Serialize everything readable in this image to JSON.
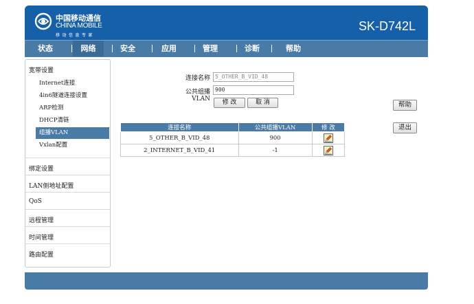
{
  "header": {
    "logo_cn": "中国移动通信",
    "logo_en": "CHINA MOBILE",
    "logo_sub": "移动信息专家",
    "model": "SK-D742L"
  },
  "nav": {
    "items": [
      {
        "label": "状态"
      },
      {
        "label": "网络"
      },
      {
        "label": "安全"
      },
      {
        "label": "应用"
      },
      {
        "label": "管理"
      },
      {
        "label": "诊断"
      },
      {
        "label": "帮助"
      }
    ],
    "active": "网络"
  },
  "sidebar": {
    "groups": [
      {
        "label": "宽带设置"
      },
      {
        "label": "绑定设置"
      },
      {
        "label": "LAN侧地址配置"
      },
      {
        "label": "QoS"
      },
      {
        "label": "远程管理"
      },
      {
        "label": "时间管理"
      },
      {
        "label": "路由配置"
      }
    ],
    "sub_items": [
      {
        "label": "Internet连接"
      },
      {
        "label": "4in6隧道连接设置"
      },
      {
        "label": "ARP检测"
      },
      {
        "label": "DHCP清链"
      },
      {
        "label": "组播VLAN"
      },
      {
        "label": "Vxlan配置"
      }
    ],
    "active_sub": "组播VLAN"
  },
  "form": {
    "conn_name_label": "连接名称",
    "conn_name_value": "5_OTHER_B_VID_48",
    "vlan_label": "公共组播VLAN",
    "vlan_value": "900",
    "modify_button": "修 改",
    "cancel_button": "取 消"
  },
  "side_buttons": {
    "help": "帮助",
    "logout": "退出"
  },
  "table": {
    "headers": [
      "连接名称",
      "公共组播VLAN",
      "修 改"
    ],
    "rows": [
      {
        "name": "5_OTHER_B_VID_48",
        "vlan": "900"
      },
      {
        "name": "2_INTERNET_B_VID_41",
        "vlan": "-1"
      }
    ]
  },
  "icons": {
    "edit": "edit-pencil-icon",
    "logo": "china-mobile-logo-icon"
  },
  "colors": {
    "header": "#1560a8",
    "nav": "#4a7ba6",
    "active_nav": "#3a6b96",
    "table_header": "#4a7ba6"
  }
}
